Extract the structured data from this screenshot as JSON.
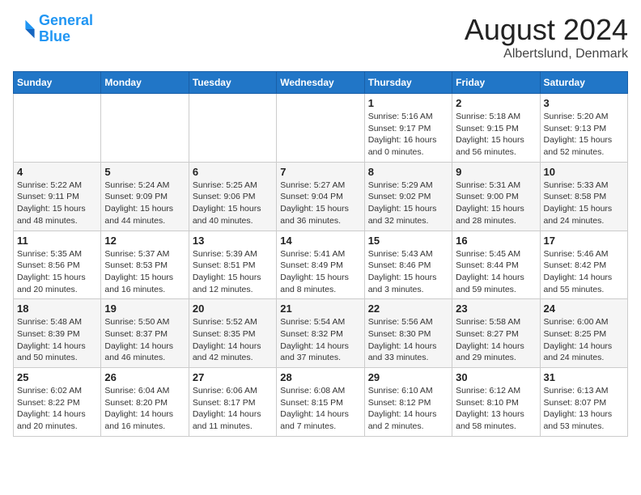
{
  "header": {
    "logo_line1": "General",
    "logo_line2": "Blue",
    "month_title": "August 2024",
    "location": "Albertslund, Denmark"
  },
  "weekdays": [
    "Sunday",
    "Monday",
    "Tuesday",
    "Wednesday",
    "Thursday",
    "Friday",
    "Saturday"
  ],
  "weeks": [
    [
      {
        "day": "",
        "info": ""
      },
      {
        "day": "",
        "info": ""
      },
      {
        "day": "",
        "info": ""
      },
      {
        "day": "",
        "info": ""
      },
      {
        "day": "1",
        "info": "Sunrise: 5:16 AM\nSunset: 9:17 PM\nDaylight: 16 hours\nand 0 minutes."
      },
      {
        "day": "2",
        "info": "Sunrise: 5:18 AM\nSunset: 9:15 PM\nDaylight: 15 hours\nand 56 minutes."
      },
      {
        "day": "3",
        "info": "Sunrise: 5:20 AM\nSunset: 9:13 PM\nDaylight: 15 hours\nand 52 minutes."
      }
    ],
    [
      {
        "day": "4",
        "info": "Sunrise: 5:22 AM\nSunset: 9:11 PM\nDaylight: 15 hours\nand 48 minutes."
      },
      {
        "day": "5",
        "info": "Sunrise: 5:24 AM\nSunset: 9:09 PM\nDaylight: 15 hours\nand 44 minutes."
      },
      {
        "day": "6",
        "info": "Sunrise: 5:25 AM\nSunset: 9:06 PM\nDaylight: 15 hours\nand 40 minutes."
      },
      {
        "day": "7",
        "info": "Sunrise: 5:27 AM\nSunset: 9:04 PM\nDaylight: 15 hours\nand 36 minutes."
      },
      {
        "day": "8",
        "info": "Sunrise: 5:29 AM\nSunset: 9:02 PM\nDaylight: 15 hours\nand 32 minutes."
      },
      {
        "day": "9",
        "info": "Sunrise: 5:31 AM\nSunset: 9:00 PM\nDaylight: 15 hours\nand 28 minutes."
      },
      {
        "day": "10",
        "info": "Sunrise: 5:33 AM\nSunset: 8:58 PM\nDaylight: 15 hours\nand 24 minutes."
      }
    ],
    [
      {
        "day": "11",
        "info": "Sunrise: 5:35 AM\nSunset: 8:56 PM\nDaylight: 15 hours\nand 20 minutes."
      },
      {
        "day": "12",
        "info": "Sunrise: 5:37 AM\nSunset: 8:53 PM\nDaylight: 15 hours\nand 16 minutes."
      },
      {
        "day": "13",
        "info": "Sunrise: 5:39 AM\nSunset: 8:51 PM\nDaylight: 15 hours\nand 12 minutes."
      },
      {
        "day": "14",
        "info": "Sunrise: 5:41 AM\nSunset: 8:49 PM\nDaylight: 15 hours\nand 8 minutes."
      },
      {
        "day": "15",
        "info": "Sunrise: 5:43 AM\nSunset: 8:46 PM\nDaylight: 15 hours\nand 3 minutes."
      },
      {
        "day": "16",
        "info": "Sunrise: 5:45 AM\nSunset: 8:44 PM\nDaylight: 14 hours\nand 59 minutes."
      },
      {
        "day": "17",
        "info": "Sunrise: 5:46 AM\nSunset: 8:42 PM\nDaylight: 14 hours\nand 55 minutes."
      }
    ],
    [
      {
        "day": "18",
        "info": "Sunrise: 5:48 AM\nSunset: 8:39 PM\nDaylight: 14 hours\nand 50 minutes."
      },
      {
        "day": "19",
        "info": "Sunrise: 5:50 AM\nSunset: 8:37 PM\nDaylight: 14 hours\nand 46 minutes."
      },
      {
        "day": "20",
        "info": "Sunrise: 5:52 AM\nSunset: 8:35 PM\nDaylight: 14 hours\nand 42 minutes."
      },
      {
        "day": "21",
        "info": "Sunrise: 5:54 AM\nSunset: 8:32 PM\nDaylight: 14 hours\nand 37 minutes."
      },
      {
        "day": "22",
        "info": "Sunrise: 5:56 AM\nSunset: 8:30 PM\nDaylight: 14 hours\nand 33 minutes."
      },
      {
        "day": "23",
        "info": "Sunrise: 5:58 AM\nSunset: 8:27 PM\nDaylight: 14 hours\nand 29 minutes."
      },
      {
        "day": "24",
        "info": "Sunrise: 6:00 AM\nSunset: 8:25 PM\nDaylight: 14 hours\nand 24 minutes."
      }
    ],
    [
      {
        "day": "25",
        "info": "Sunrise: 6:02 AM\nSunset: 8:22 PM\nDaylight: 14 hours\nand 20 minutes."
      },
      {
        "day": "26",
        "info": "Sunrise: 6:04 AM\nSunset: 8:20 PM\nDaylight: 14 hours\nand 16 minutes."
      },
      {
        "day": "27",
        "info": "Sunrise: 6:06 AM\nSunset: 8:17 PM\nDaylight: 14 hours\nand 11 minutes."
      },
      {
        "day": "28",
        "info": "Sunrise: 6:08 AM\nSunset: 8:15 PM\nDaylight: 14 hours\nand 7 minutes."
      },
      {
        "day": "29",
        "info": "Sunrise: 6:10 AM\nSunset: 8:12 PM\nDaylight: 14 hours\nand 2 minutes."
      },
      {
        "day": "30",
        "info": "Sunrise: 6:12 AM\nSunset: 8:10 PM\nDaylight: 13 hours\nand 58 minutes."
      },
      {
        "day": "31",
        "info": "Sunrise: 6:13 AM\nSunset: 8:07 PM\nDaylight: 13 hours\nand 53 minutes."
      }
    ]
  ]
}
